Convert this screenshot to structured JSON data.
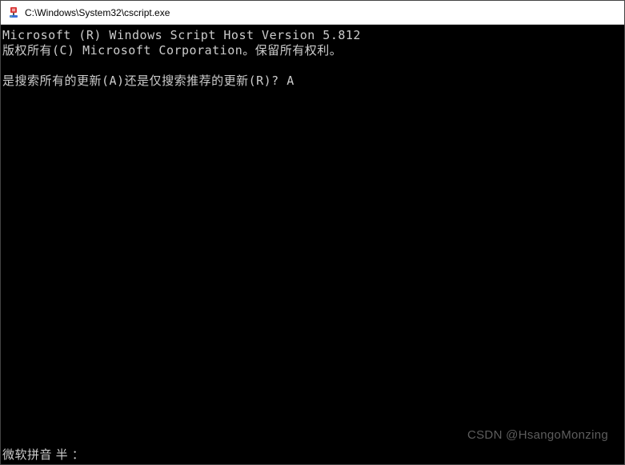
{
  "window": {
    "title": "C:\\Windows\\System32\\cscript.exe"
  },
  "terminal": {
    "header_line1": "Microsoft (R) Windows Script Host Version 5.812",
    "header_line2": "版权所有(C) Microsoft Corporation。保留所有权利。",
    "prompt_question": "是搜索所有的更新(A)还是仅搜索推荐的更新(R)? ",
    "prompt_answer": "A"
  },
  "ime": {
    "status": "微软拼音 半 ："
  },
  "watermark": {
    "text": "CSDN @HsangoMonzing"
  }
}
